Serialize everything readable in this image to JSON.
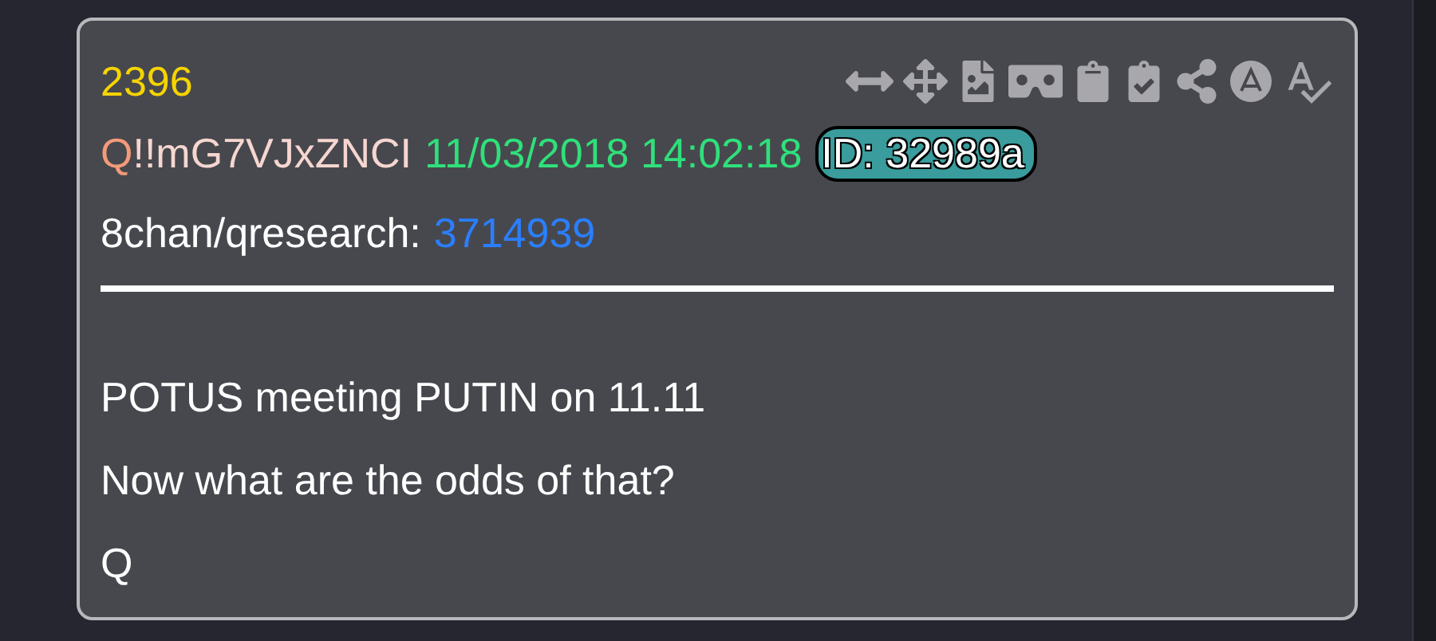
{
  "post": {
    "number": "2396",
    "name": "Q",
    "tripcode": "!!mG7VJxZNCI",
    "date": "11/03/2018 14:02:18",
    "id_label": "ID: 32989a",
    "source": "8chan/qresearch:",
    "ref": "3714939"
  },
  "body": [
    "POTUS meeting PUTIN on 11.11",
    "Now what are the odds of that?",
    "Q"
  ]
}
